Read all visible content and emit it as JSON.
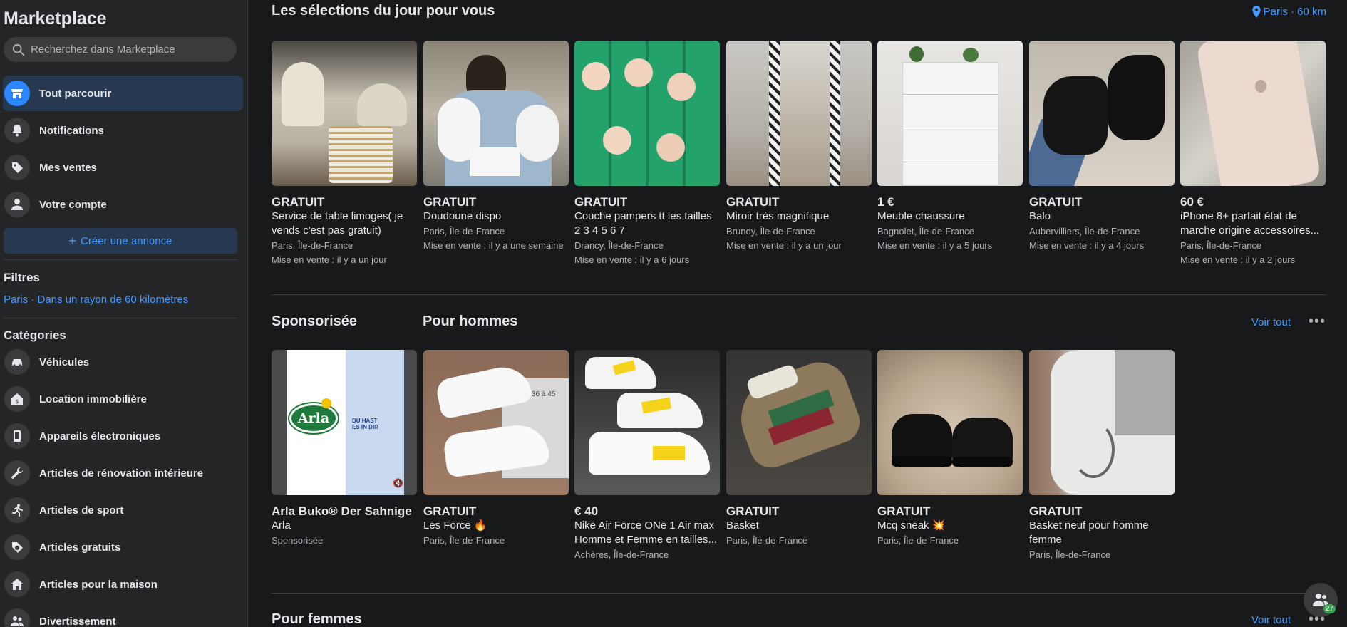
{
  "sidebar": {
    "title": "Marketplace",
    "search_placeholder": "Recherchez dans Marketplace",
    "nav": [
      {
        "label": "Tout parcourir"
      },
      {
        "label": "Notifications"
      },
      {
        "label": "Mes ventes"
      },
      {
        "label": "Votre compte"
      }
    ],
    "create_label": "Créer une annonce",
    "filters_title": "Filtres",
    "filter_location": "Paris · Dans un rayon de 60 kilomètres",
    "categories_title": "Catégories",
    "categories": [
      {
        "label": "Véhicules"
      },
      {
        "label": "Location immobilière"
      },
      {
        "label": "Appareils électroniques"
      },
      {
        "label": "Articles de rénovation intérieure"
      },
      {
        "label": "Articles de sport"
      },
      {
        "label": "Articles gratuits"
      },
      {
        "label": "Articles pour la maison"
      },
      {
        "label": "Divertissement"
      }
    ]
  },
  "main": {
    "daily": {
      "title": "Les sélections du jour pour vous",
      "location": "Paris · 60 km",
      "items": [
        {
          "price": "GRATUIT",
          "title": "Service de table limoges( je vends c'est pas gratuit)",
          "city": "Paris, Île-de-France",
          "date": "Mise en vente : il y a un jour"
        },
        {
          "price": "GRATUIT",
          "title": "Doudoune dispo",
          "city": "Paris, Île-de-France",
          "date": "Mise en vente : il y a une semaine"
        },
        {
          "price": "GRATUIT",
          "title": "Couche pampers tt les tailles 2 3 4 5 6 7",
          "city": "Drancy, Île-de-France",
          "date": "Mise en vente : il y a 6 jours"
        },
        {
          "price": "GRATUIT",
          "title": "Miroir très magnifique",
          "city": "Brunoy, Île-de-France",
          "date": "Mise en vente : il y a un jour"
        },
        {
          "price": "1 €",
          "title": "Meuble chaussure",
          "city": "Bagnolet, Île-de-France",
          "date": "Mise en vente : il y a 5 jours"
        },
        {
          "price": "GRATUIT",
          "title": "Balo",
          "city": "Aubervilliers, Île-de-France",
          "date": "Mise en vente : il y a 4 jours"
        },
        {
          "price": "60 €",
          "title": "iPhone 8+ parfait état de marche origine accessoires...",
          "city": "Paris, Île-de-France",
          "date": "Mise en vente : il y a 2 jours"
        }
      ]
    },
    "men": {
      "sponsored_title": "Sponsorisée",
      "title": "Pour hommes",
      "see_all": "Voir tout",
      "more": "•••",
      "ad": {
        "title": "Arla Buko® Der Sahnige",
        "brand": "Arla",
        "tag": "Sponsorisée",
        "logo": "Arla",
        "slogan_1": "DU HAST",
        "slogan_2": "ES IN DIR"
      },
      "items": [
        {
          "price": "GRATUIT",
          "title": "Les Force 🔥",
          "city": "Paris, Île-de-France",
          "box_label": "36 à 45"
        },
        {
          "price": "€ 40",
          "title": "Nike Air Force ONe 1 Air max Homme et Femme en tailles...",
          "city": "Achères, Île-de-France"
        },
        {
          "price": "GRATUIT",
          "title": "Basket",
          "city": "Paris, Île-de-France"
        },
        {
          "price": "GRATUIT",
          "title": "Mcq sneak 💥",
          "city": "Paris, Île-de-France"
        },
        {
          "price": "GRATUIT",
          "title": "Basket neuf pour homme femme",
          "city": "Paris, Île-de-France"
        }
      ]
    },
    "women": {
      "title": "Pour femmes",
      "see_all": "Voir tout",
      "more": "•••"
    },
    "fab_badge": "27"
  },
  "colors": {
    "background": "#18191a",
    "sidebar": "#242526",
    "accent": "#2d88ff",
    "link": "#4599ff",
    "text": "#e4e6eb",
    "muted": "#b0b3b8"
  }
}
